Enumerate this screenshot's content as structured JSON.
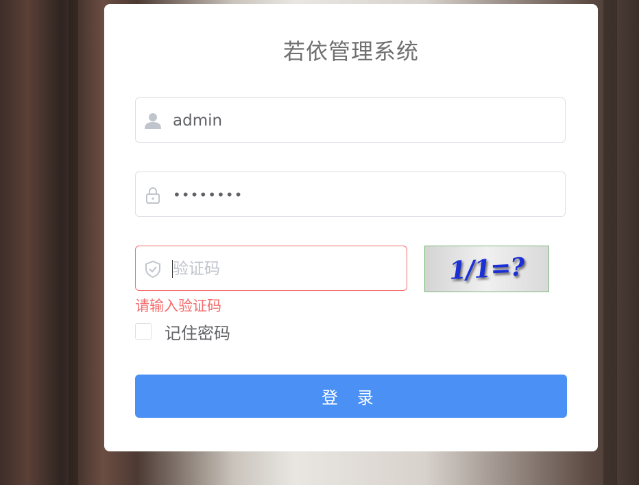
{
  "login": {
    "title": "若依管理系统",
    "username": {
      "value": "admin",
      "icon": "user-icon"
    },
    "password": {
      "masked_value": "••••••••",
      "icon": "lock-icon"
    },
    "captcha": {
      "placeholder": "验证码",
      "icon": "shield-icon",
      "image_text": "1/1=?"
    },
    "captcha_error": "请输入验证码",
    "remember_label": "记住密码",
    "submit_label": "登 录"
  },
  "colors": {
    "primary": "#4a90f5",
    "error": "#f56c6c",
    "captcha_text": "#1a2fd6"
  }
}
